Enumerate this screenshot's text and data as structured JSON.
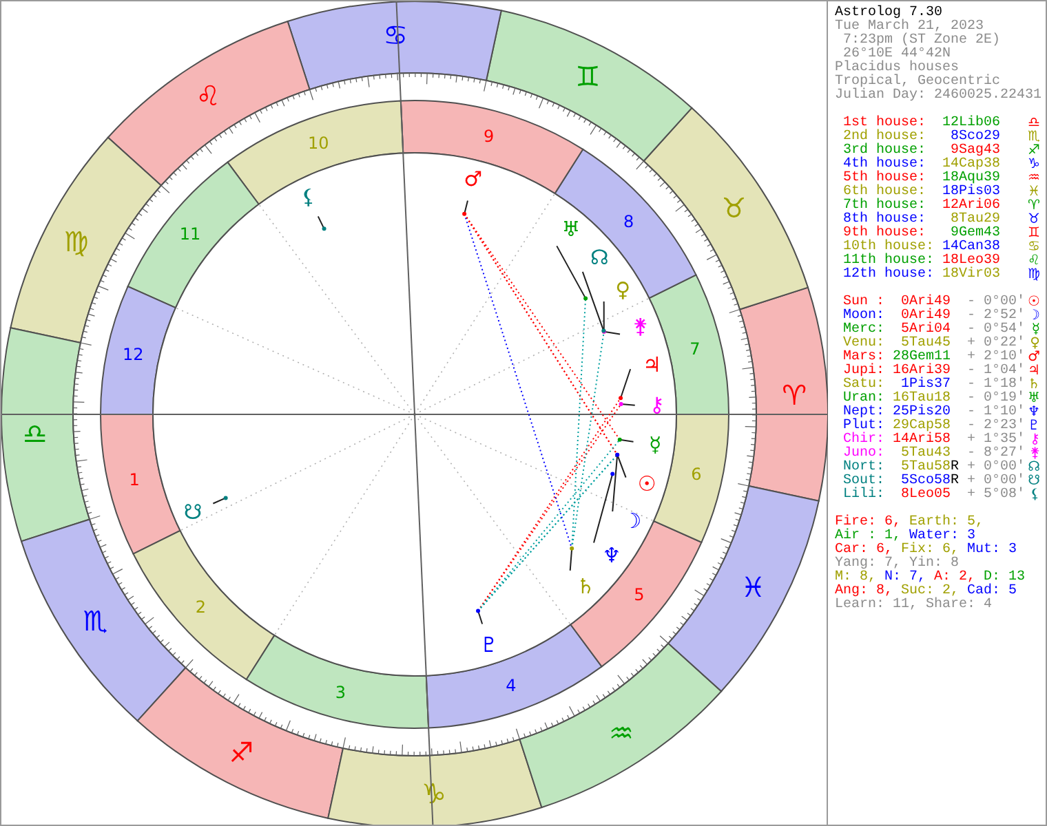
{
  "title": "Astrolog 7.30",
  "info": [
    "Tue March 21, 2023",
    " 7:23pm (ST Zone 2E)",
    " 26°10E 44°42N",
    "Placidus houses",
    "Tropical, Geocentric",
    "Julian Day: 2460025.22431"
  ],
  "houses": [
    {
      "label": "1st house:",
      "position": {
        "text": "12Lib06",
        "color": "#00a000"
      },
      "glyph": "♎",
      "color": "#ff0000"
    },
    {
      "label": "2nd house:",
      "position": {
        "text": "8Sco29",
        "color": "#0000ff"
      },
      "glyph": "♏",
      "color": "#a0a000"
    },
    {
      "label": "3rd house:",
      "position": {
        "text": "9Sag43",
        "color": "#ff0000"
      },
      "glyph": "♐",
      "color": "#00a000"
    },
    {
      "label": "4th house:",
      "position": {
        "text": "14Cap38",
        "color": "#a0a000"
      },
      "glyph": "♑",
      "color": "#0000ff"
    },
    {
      "label": "5th house:",
      "position": {
        "text": "18Aqu39",
        "color": "#00a000"
      },
      "glyph": "♒",
      "color": "#ff0000"
    },
    {
      "label": "6th house:",
      "position": {
        "text": "18Pis03",
        "color": "#0000ff"
      },
      "glyph": "♓",
      "color": "#a0a000"
    },
    {
      "label": "7th house:",
      "position": {
        "text": "12Ari06",
        "color": "#ff0000"
      },
      "glyph": "♈",
      "color": "#00a000"
    },
    {
      "label": "8th house:",
      "position": {
        "text": "8Tau29",
        "color": "#a0a000"
      },
      "glyph": "♉",
      "color": "#0000ff"
    },
    {
      "label": "9th house:",
      "position": {
        "text": "9Gem43",
        "color": "#00a000"
      },
      "glyph": "♊",
      "color": "#ff0000"
    },
    {
      "label": "10th house:",
      "position": {
        "text": "14Can38",
        "color": "#0000ff"
      },
      "glyph": "♋",
      "color": "#a0a000"
    },
    {
      "label": "11th house:",
      "position": {
        "text": "18Leo39",
        "color": "#ff0000"
      },
      "glyph": "♌",
      "color": "#00a000"
    },
    {
      "label": "12th house:",
      "position": {
        "text": "18Vir03",
        "color": "#a0a000"
      },
      "glyph": "♍",
      "color": "#0000ff"
    }
  ],
  "planets": [
    {
      "name": "Sun :",
      "position": {
        "text": "0Ari49",
        "color": "#ff0000"
      },
      "speed": "- 0°00'",
      "glyph": "☉",
      "color": "#ff0000"
    },
    {
      "name": "Moon:",
      "position": {
        "text": "0Ari49",
        "color": "#ff0000"
      },
      "speed": "- 2°52'",
      "glyph": "☽",
      "color": "#0000ff"
    },
    {
      "name": "Merc:",
      "position": {
        "text": "5Ari04",
        "color": "#ff0000"
      },
      "speed": "- 0°54'",
      "glyph": "☿",
      "color": "#00a000"
    },
    {
      "name": "Venu:",
      "position": {
        "text": "5Tau45",
        "color": "#a0a000"
      },
      "speed": "+ 0°22'",
      "glyph": "♀",
      "color": "#a0a000"
    },
    {
      "name": "Mars:",
      "position": {
        "text": "28Gem11",
        "color": "#00a000"
      },
      "speed": "+ 2°10'",
      "glyph": "♂",
      "color": "#ff0000"
    },
    {
      "name": "Jupi:",
      "position": {
        "text": "16Ari39",
        "color": "#ff0000"
      },
      "speed": "- 1°04'",
      "glyph": "♃",
      "color": "#ff0000"
    },
    {
      "name": "Satu:",
      "position": {
        "text": "1Pis37",
        "color": "#0000ff"
      },
      "speed": "- 1°18'",
      "glyph": "♄",
      "color": "#a0a000"
    },
    {
      "name": "Uran:",
      "position": {
        "text": "16Tau18",
        "color": "#a0a000"
      },
      "speed": "- 0°19'",
      "glyph": "♅",
      "color": "#00a000"
    },
    {
      "name": "Nept:",
      "position": {
        "text": "25Pis20",
        "color": "#0000ff"
      },
      "speed": "- 1°10'",
      "glyph": "♆",
      "color": "#0000ff"
    },
    {
      "name": "Plut:",
      "position": {
        "text": "29Cap58",
        "color": "#a0a000"
      },
      "speed": "- 2°23'",
      "glyph": "♇",
      "color": "#0000ff"
    },
    {
      "name": "Chir:",
      "position": {
        "text": "14Ari58",
        "color": "#ff0000"
      },
      "speed": "+ 1°35'",
      "glyph": "⚷",
      "color": "#ff00ff"
    },
    {
      "name": "Juno:",
      "position": {
        "text": "5Tau43",
        "color": "#a0a000"
      },
      "speed": "- 8°27'",
      "glyph": "⚵",
      "color": "#ff00ff"
    },
    {
      "name": "Nort:",
      "position": {
        "text": "5Tau58",
        "color": "#a0a000"
      },
      "retro": "R",
      "speed": "+ 0°00'",
      "glyph": "☊",
      "color": "#008080"
    },
    {
      "name": "Sout:",
      "position": {
        "text": "5Sco58",
        "color": "#0000ff"
      },
      "retro": "R",
      "speed": "+ 0°00'",
      "glyph": "☋",
      "color": "#008080"
    },
    {
      "name": "Lili:",
      "position": {
        "text": "8Leo05",
        "color": "#ff0000"
      },
      "speed": "+ 5°08'",
      "glyph": "⚸",
      "color": "#008080"
    }
  ],
  "stats": [
    [
      {
        "text": "Fire: 6,",
        "color": "#ff0000"
      },
      {
        "text": "Earth: 5,",
        "color": "#a0a000"
      }
    ],
    [
      {
        "text": "Air : 1,",
        "color": "#00a000"
      },
      {
        "text": "Water: 3",
        "color": "#0000ff"
      }
    ],
    [
      {
        "text": "Car: 6,",
        "color": "#ff0000"
      },
      {
        "text": "Fix: 6,",
        "color": "#a0a000"
      },
      {
        "text": "Mut: 3",
        "color": "#0000ff"
      }
    ],
    [
      {
        "text": "Yang: 7,",
        "color": "#8c8c8c"
      },
      {
        "text": "Yin: 8",
        "color": "#8c8c8c"
      }
    ],
    [
      {
        "text": "M: 8,",
        "color": "#a0a000"
      },
      {
        "text": "N: 7,",
        "color": "#0000ff"
      },
      {
        "text": "A: 2,",
        "color": "#ff0000"
      },
      {
        "text": "D: 13",
        "color": "#00a000"
      }
    ],
    [
      {
        "text": "Ang: 8,",
        "color": "#ff0000"
      },
      {
        "text": "Suc: 2,",
        "color": "#a0a000"
      },
      {
        "text": "Cad: 5",
        "color": "#0000ff"
      }
    ],
    [
      {
        "text": "Learn: 11,",
        "color": "#8c8c8c"
      },
      {
        "text": "Share: 4",
        "color": "#8c8c8c"
      }
    ]
  ],
  "wheel": {
    "signs": [
      {
        "glyph": "♈",
        "color": "#ff0000"
      },
      {
        "glyph": "♉",
        "color": "#a0a000"
      },
      {
        "glyph": "♊",
        "color": "#00a000"
      },
      {
        "glyph": "♋",
        "color": "#0000ff"
      },
      {
        "glyph": "♌",
        "color": "#ff0000"
      },
      {
        "glyph": "♍",
        "color": "#a0a000"
      },
      {
        "glyph": "♎",
        "color": "#00a000"
      },
      {
        "glyph": "♏",
        "color": "#0000ff"
      },
      {
        "glyph": "♐",
        "color": "#ff0000"
      },
      {
        "glyph": "♑",
        "color": "#a0a000"
      },
      {
        "glyph": "♒",
        "color": "#00a000"
      },
      {
        "glyph": "♓",
        "color": "#0000ff"
      }
    ],
    "house_numbers": [
      {
        "text": "1",
        "color": "#ff0000"
      },
      {
        "text": "2",
        "color": "#a0a000"
      },
      {
        "text": "3",
        "color": "#00a000"
      },
      {
        "text": "4",
        "color": "#0000ff"
      },
      {
        "text": "5",
        "color": "#ff0000"
      },
      {
        "text": "6",
        "color": "#a0a000"
      },
      {
        "text": "7",
        "color": "#00a000"
      },
      {
        "text": "8",
        "color": "#0000ff"
      },
      {
        "text": "9",
        "color": "#ff0000"
      },
      {
        "text": "10",
        "color": "#a0a000"
      },
      {
        "text": "11",
        "color": "#00a000"
      },
      {
        "text": "12",
        "color": "#0000ff"
      }
    ],
    "planets": [
      {
        "glyph": "☉",
        "color": "#ff0000"
      },
      {
        "glyph": "☽",
        "color": "#0000ff"
      },
      {
        "glyph": "☿",
        "color": "#00a000"
      },
      {
        "glyph": "♀",
        "color": "#a0a000"
      },
      {
        "glyph": "♂",
        "color": "#ff0000"
      },
      {
        "glyph": "♃",
        "color": "#ff0000"
      },
      {
        "glyph": "♄",
        "color": "#a0a000"
      },
      {
        "glyph": "♅",
        "color": "#00a000"
      },
      {
        "glyph": "♆",
        "color": "#0000ff"
      },
      {
        "glyph": "♇",
        "color": "#0000ff"
      },
      {
        "glyph": "⚷",
        "color": "#ff00ff"
      },
      {
        "glyph": "⚵",
        "color": "#ff00ff"
      },
      {
        "glyph": "☊",
        "color": "#008080"
      },
      {
        "glyph": "☋",
        "color": "#008080"
      },
      {
        "glyph": "⚸",
        "color": "#008080"
      }
    ]
  }
}
